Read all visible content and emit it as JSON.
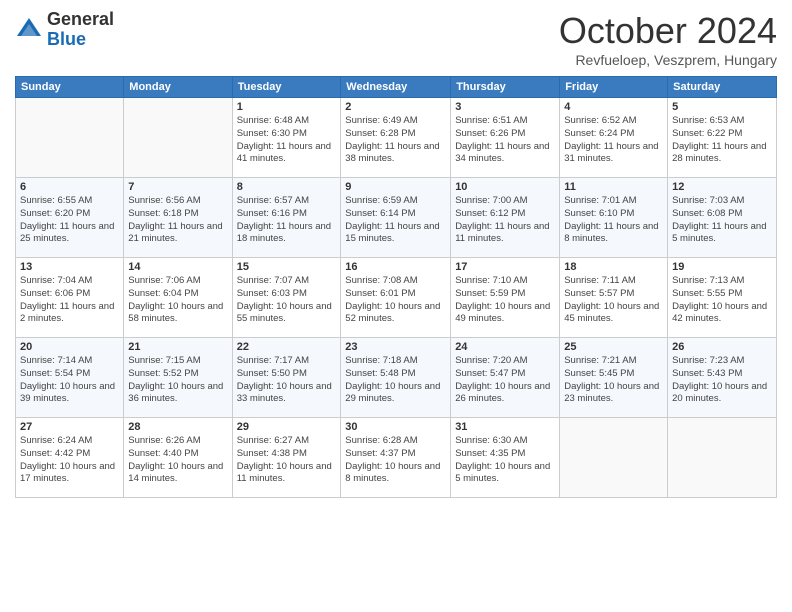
{
  "header": {
    "logo_general": "General",
    "logo_blue": "Blue",
    "month_title": "October 2024",
    "location": "Revfueloep, Veszprem, Hungary"
  },
  "days_of_week": [
    "Sunday",
    "Monday",
    "Tuesday",
    "Wednesday",
    "Thursday",
    "Friday",
    "Saturday"
  ],
  "weeks": [
    [
      {
        "day": "",
        "info": ""
      },
      {
        "day": "",
        "info": ""
      },
      {
        "day": "1",
        "info": "Sunrise: 6:48 AM\nSunset: 6:30 PM\nDaylight: 11 hours and 41 minutes."
      },
      {
        "day": "2",
        "info": "Sunrise: 6:49 AM\nSunset: 6:28 PM\nDaylight: 11 hours and 38 minutes."
      },
      {
        "day": "3",
        "info": "Sunrise: 6:51 AM\nSunset: 6:26 PM\nDaylight: 11 hours and 34 minutes."
      },
      {
        "day": "4",
        "info": "Sunrise: 6:52 AM\nSunset: 6:24 PM\nDaylight: 11 hours and 31 minutes."
      },
      {
        "day": "5",
        "info": "Sunrise: 6:53 AM\nSunset: 6:22 PM\nDaylight: 11 hours and 28 minutes."
      }
    ],
    [
      {
        "day": "6",
        "info": "Sunrise: 6:55 AM\nSunset: 6:20 PM\nDaylight: 11 hours and 25 minutes."
      },
      {
        "day": "7",
        "info": "Sunrise: 6:56 AM\nSunset: 6:18 PM\nDaylight: 11 hours and 21 minutes."
      },
      {
        "day": "8",
        "info": "Sunrise: 6:57 AM\nSunset: 6:16 PM\nDaylight: 11 hours and 18 minutes."
      },
      {
        "day": "9",
        "info": "Sunrise: 6:59 AM\nSunset: 6:14 PM\nDaylight: 11 hours and 15 minutes."
      },
      {
        "day": "10",
        "info": "Sunrise: 7:00 AM\nSunset: 6:12 PM\nDaylight: 11 hours and 11 minutes."
      },
      {
        "day": "11",
        "info": "Sunrise: 7:01 AM\nSunset: 6:10 PM\nDaylight: 11 hours and 8 minutes."
      },
      {
        "day": "12",
        "info": "Sunrise: 7:03 AM\nSunset: 6:08 PM\nDaylight: 11 hours and 5 minutes."
      }
    ],
    [
      {
        "day": "13",
        "info": "Sunrise: 7:04 AM\nSunset: 6:06 PM\nDaylight: 11 hours and 2 minutes."
      },
      {
        "day": "14",
        "info": "Sunrise: 7:06 AM\nSunset: 6:04 PM\nDaylight: 10 hours and 58 minutes."
      },
      {
        "day": "15",
        "info": "Sunrise: 7:07 AM\nSunset: 6:03 PM\nDaylight: 10 hours and 55 minutes."
      },
      {
        "day": "16",
        "info": "Sunrise: 7:08 AM\nSunset: 6:01 PM\nDaylight: 10 hours and 52 minutes."
      },
      {
        "day": "17",
        "info": "Sunrise: 7:10 AM\nSunset: 5:59 PM\nDaylight: 10 hours and 49 minutes."
      },
      {
        "day": "18",
        "info": "Sunrise: 7:11 AM\nSunset: 5:57 PM\nDaylight: 10 hours and 45 minutes."
      },
      {
        "day": "19",
        "info": "Sunrise: 7:13 AM\nSunset: 5:55 PM\nDaylight: 10 hours and 42 minutes."
      }
    ],
    [
      {
        "day": "20",
        "info": "Sunrise: 7:14 AM\nSunset: 5:54 PM\nDaylight: 10 hours and 39 minutes."
      },
      {
        "day": "21",
        "info": "Sunrise: 7:15 AM\nSunset: 5:52 PM\nDaylight: 10 hours and 36 minutes."
      },
      {
        "day": "22",
        "info": "Sunrise: 7:17 AM\nSunset: 5:50 PM\nDaylight: 10 hours and 33 minutes."
      },
      {
        "day": "23",
        "info": "Sunrise: 7:18 AM\nSunset: 5:48 PM\nDaylight: 10 hours and 29 minutes."
      },
      {
        "day": "24",
        "info": "Sunrise: 7:20 AM\nSunset: 5:47 PM\nDaylight: 10 hours and 26 minutes."
      },
      {
        "day": "25",
        "info": "Sunrise: 7:21 AM\nSunset: 5:45 PM\nDaylight: 10 hours and 23 minutes."
      },
      {
        "day": "26",
        "info": "Sunrise: 7:23 AM\nSunset: 5:43 PM\nDaylight: 10 hours and 20 minutes."
      }
    ],
    [
      {
        "day": "27",
        "info": "Sunrise: 6:24 AM\nSunset: 4:42 PM\nDaylight: 10 hours and 17 minutes."
      },
      {
        "day": "28",
        "info": "Sunrise: 6:26 AM\nSunset: 4:40 PM\nDaylight: 10 hours and 14 minutes."
      },
      {
        "day": "29",
        "info": "Sunrise: 6:27 AM\nSunset: 4:38 PM\nDaylight: 10 hours and 11 minutes."
      },
      {
        "day": "30",
        "info": "Sunrise: 6:28 AM\nSunset: 4:37 PM\nDaylight: 10 hours and 8 minutes."
      },
      {
        "day": "31",
        "info": "Sunrise: 6:30 AM\nSunset: 4:35 PM\nDaylight: 10 hours and 5 minutes."
      },
      {
        "day": "",
        "info": ""
      },
      {
        "day": "",
        "info": ""
      }
    ]
  ]
}
